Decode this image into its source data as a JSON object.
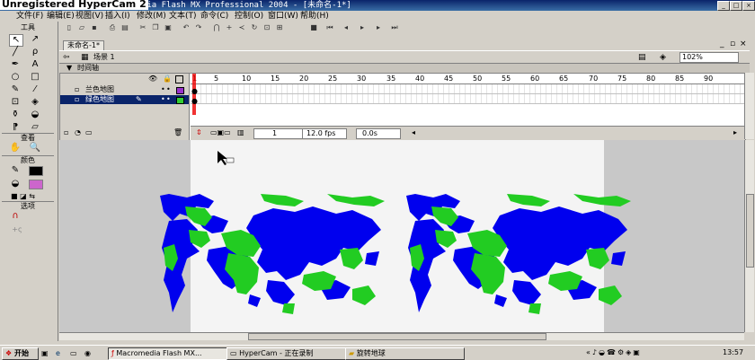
{
  "titlebar": {
    "watermark": "Unregistered HyperCam 2",
    "title": "Macromedia Flash MX Professional 2004 - [未命名-1*]",
    "buttons": [
      "_",
      "□",
      "×"
    ]
  },
  "menubar": {
    "items": [
      "文件(F)",
      "编辑(E)",
      "视图(V)",
      "插入(I)",
      "修改(M)",
      "文本(T)",
      "命令(C)",
      "控制(O)",
      "窗口(W)",
      "帮助(H)"
    ]
  },
  "tools_panel": {
    "title": "工具",
    "view_title": "查看",
    "colors_title": "颜色",
    "options_title": "选项",
    "stroke_color": "#000000",
    "fill_color": "#cc66cc"
  },
  "document": {
    "tab_label": "未命名-1*",
    "scene_label": "场景 1",
    "zoom": "102%"
  },
  "timeline": {
    "header_label": "时间轴",
    "frame_numbers": [
      "1",
      "5",
      "10",
      "15",
      "20",
      "25",
      "30",
      "35",
      "40",
      "45",
      "50",
      "55",
      "60",
      "65",
      "70",
      "75",
      "80",
      "85",
      "90"
    ],
    "layers": [
      {
        "name": "兰色地图",
        "color": "#9933cc",
        "selected": false
      },
      {
        "name": "绿色地图",
        "color": "#33cc33",
        "selected": true
      }
    ],
    "current_frame": "1",
    "fps": "12.0 fps",
    "elapsed": "0.0s"
  },
  "taskbar": {
    "start_label": "开始",
    "tasks": [
      "Macromedia Flash MX...",
      "HyperCam - 正在录制",
      "旋转地球"
    ],
    "clock": "13:57"
  },
  "colors": {
    "map_blue": "#0000ee",
    "map_green": "#22cc22"
  }
}
